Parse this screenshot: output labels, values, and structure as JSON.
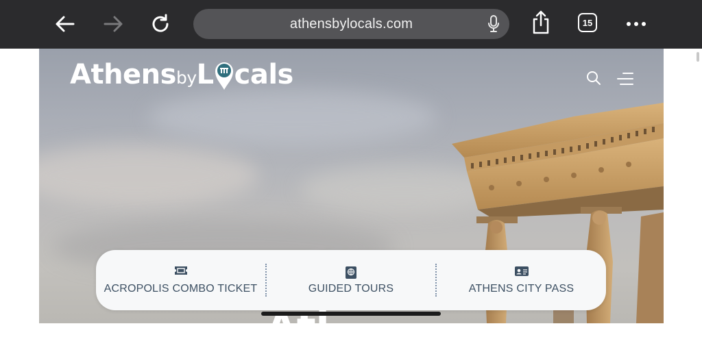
{
  "browser": {
    "url": "athensbylocals.com",
    "tab_count": "15",
    "icons": [
      "back-arrow-icon",
      "forward-arrow-icon",
      "reload-icon",
      "microphone-icon",
      "share-icon",
      "tabs-icon",
      "more-icon"
    ]
  },
  "site": {
    "logo": {
      "part1": "Athens",
      "part2": "by",
      "part3": "L",
      "part4": "cals"
    },
    "header_icons": [
      "search-icon",
      "menu-icon"
    ],
    "hero_title_partial": "Atl",
    "quick_links": [
      {
        "label": "ACROPOLIS COMBO TICKET",
        "icon": "ticket-icon"
      },
      {
        "label": "GUIDED TOURS",
        "icon": "guidebook-icon"
      },
      {
        "label": "ATHENS CITY PASS",
        "icon": "id-card-icon"
      }
    ]
  },
  "colors": {
    "toolbar_bg": "#2b2b2d",
    "urlbar_bg": "#545457",
    "quickbar_bg": "#f7f8f9",
    "quicklink_text": "#3c4f62",
    "logo_pin": "#2f6f7d"
  }
}
